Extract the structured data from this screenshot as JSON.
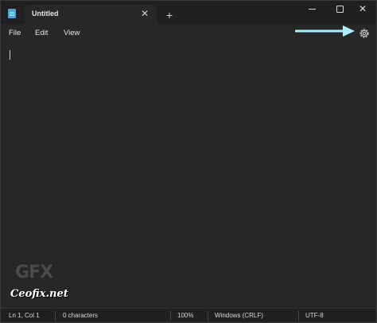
{
  "tab": {
    "title": "Untitled"
  },
  "menu": {
    "file": "File",
    "edit": "Edit",
    "view": "View"
  },
  "watermark": {
    "logo": "GFX",
    "site": "Ceofix.net"
  },
  "status": {
    "position": "Ln 1, Col 1",
    "characters": "0 characters",
    "zoom": "100%",
    "line_ending": "Windows (CRLF)",
    "encoding": "UTF-8"
  },
  "colors": {
    "annotation_arrow": "#a8f0ff",
    "app_icon": "#4aa3df"
  }
}
